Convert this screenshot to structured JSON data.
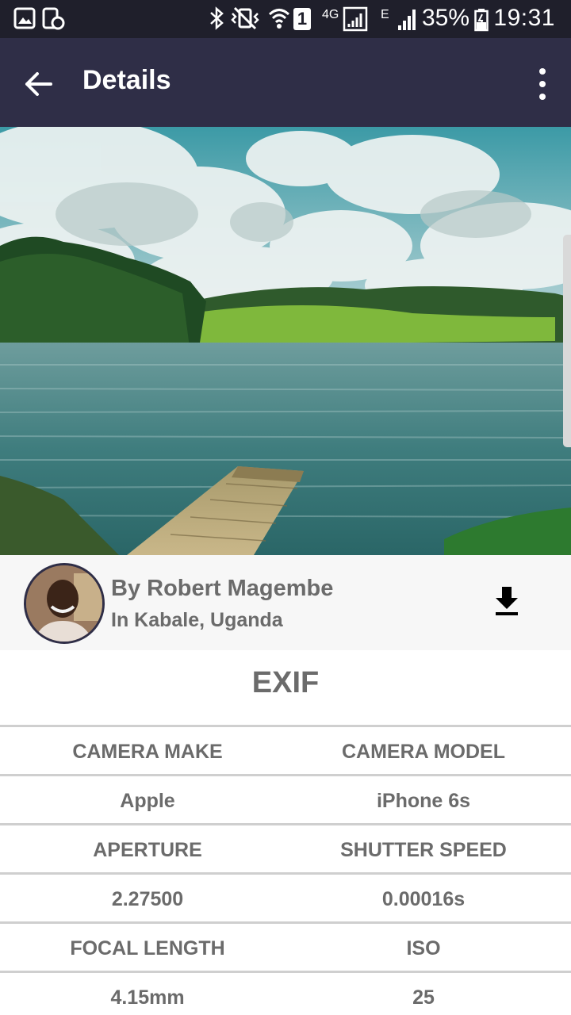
{
  "status_bar": {
    "battery": "35%",
    "time": "19:31",
    "network_4g": "4G",
    "network_e": "E",
    "sim": "1"
  },
  "appbar": {
    "title": "Details"
  },
  "author": {
    "name": "By Robert Magembe",
    "location": "In Kabale, Uganda"
  },
  "exif": {
    "title": "EXIF",
    "rows": [
      {
        "left": "CAMERA MAKE",
        "right": "CAMERA MODEL"
      },
      {
        "left": "Apple",
        "right": "iPhone 6s"
      },
      {
        "left": "APERTURE",
        "right": "SHUTTER SPEED"
      },
      {
        "left": "2.27500",
        "right": "0.00016s"
      },
      {
        "left": "FOCAL LENGTH",
        "right": "ISO"
      },
      {
        "left": "4.15mm",
        "right": "25"
      }
    ]
  }
}
